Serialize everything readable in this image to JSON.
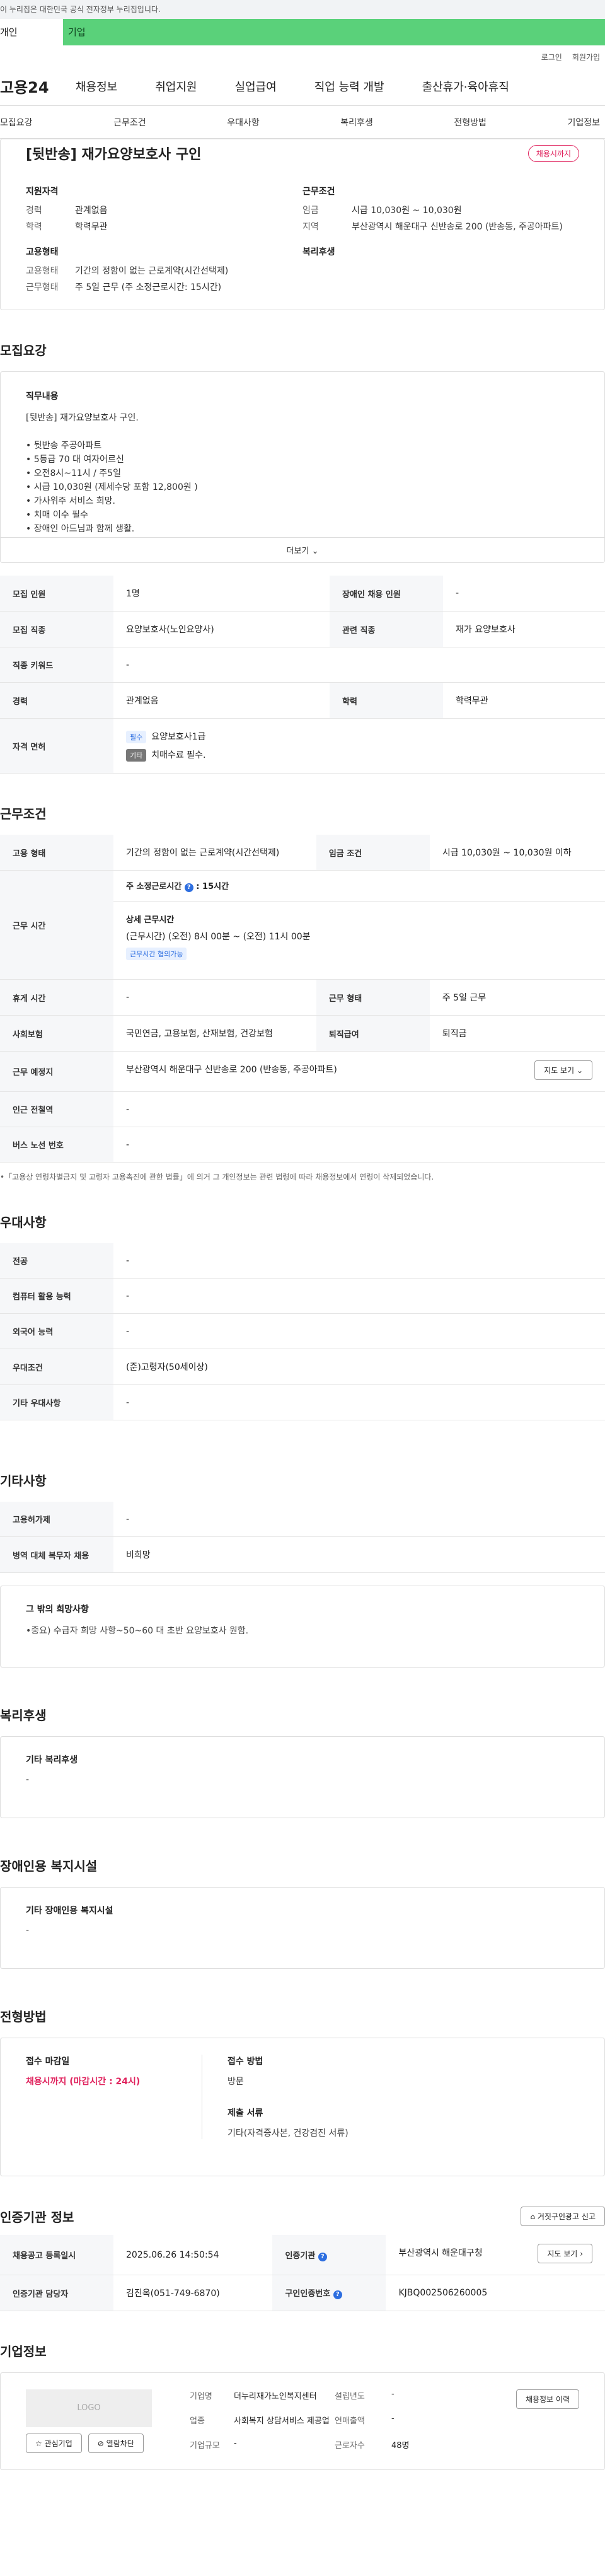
{
  "topbar": "이 누리집은 대한민국 공식 전자정부 누리집입니다.",
  "tabs": {
    "person": "개인",
    "company": "기업"
  },
  "util": {
    "login": "로그인",
    "join": "회원가입"
  },
  "logo": "고용24",
  "gnb": [
    "채용정보",
    "취업지원",
    "실업급여",
    "직업 능력 개발",
    "출산휴가·육아휴직"
  ],
  "subnav": [
    "모집요강",
    "근무조건",
    "우대사항",
    "복리후생",
    "전형방법",
    "기업정보"
  ],
  "job": {
    "title": "[뒷반송] 재가요양보호사 구인",
    "deadline_badge": "채용시까지",
    "qual_title": "지원자격",
    "career_label": "경력",
    "career": "관계없음",
    "edu_label": "학력",
    "edu": "학력무관",
    "cond_title": "근무조건",
    "wage_label": "임금",
    "wage": "시급 10,030원 ~ 10,030원",
    "area_label": "지역",
    "area": "부산광역시 해운대구 신반송로 200 (반송동, 주공아파트)",
    "type_title": "고용형태",
    "emp_label": "고용형태",
    "emp": "기간의 정함이 없는 근로계약(시간선택제)",
    "work_label": "근무형태",
    "work": "주 5일 근무 (주 소정근로시간: 15시간)",
    "welfare_title": "복리후생"
  },
  "recruit": {
    "section": "모집요강",
    "desc_title": "직무내용",
    "desc_lines": [
      "[뒷반송] 재가요양보호사 구인.",
      "",
      "• 뒷반송 주공아파트",
      "• 5등급 70 대 여자어르신",
      "• 오전8시~11시 / 주5일",
      "• 시급 10,030원 (제세수당 포함 12,800원 )",
      "• 가사위주 서비스 희망.",
      "• 치매 이수 필수",
      "• 장애인 아드님과 함께 생활."
    ],
    "more": "더보기",
    "rows": {
      "count_label": "모집 인원",
      "count": "1명",
      "disabled_label": "장애인 채용 인원",
      "disabled": "-",
      "job_label": "모집 직종",
      "job": "요양보호사(노인요양사)",
      "related_label": "관련 직종",
      "related": "재가 요양보호사",
      "keyword_label": "직종 키워드",
      "keyword": "-",
      "career_label": "경력",
      "career": "관계없음",
      "edu_label": "학력",
      "edu": "학력무관",
      "license_label": "자격 면허",
      "license_tag1": "필수",
      "license1": "요양보호사1급",
      "license_tag2": "기타",
      "license2": "치매수료 필수."
    }
  },
  "conditions": {
    "section": "근무조건",
    "emp_label": "고용 형태",
    "emp": "기간의 정함이 없는 근로계약(시간선택제)",
    "wage_label": "임금 조건",
    "wage": "시급 10,030원 ~ 10,030원 이하",
    "time_label": "근무 시간",
    "weekly": "주 소정근로시간",
    "weekly_hours": "15시간",
    "detail_title": "상세 근무시간",
    "detail": "(근무시간) (오전) 8시 00분 ~ (오전) 11시 00분",
    "detail_tag": "근무시간 협의가능",
    "rest_label": "휴게 시간",
    "rest": "-",
    "form_label": "근무 형태",
    "form": "주 5일 근무",
    "insurance_label": "사회보험",
    "insurance": "국민연금, 고용보험, 산재보험, 건강보험",
    "severance_label": "퇴직급여",
    "severance": "퇴직금",
    "place_label": "근무 예정지",
    "place": "부산광역시 해운대구 신반송로 200 (반송동, 주공아파트)",
    "map_btn": "지도 보기",
    "station_label": "인근 전철역",
    "station": "-",
    "bus_label": "버스 노선 번호",
    "bus": "-",
    "note": "•「고용상 연령차별금지 및 고령자 고용촉진에 관한 법률」에 의거 그 개인정보는 관련 법령에 따라 채용정보에서 연령이 삭제되었습니다."
  },
  "preference": {
    "section": "우대사항",
    "rows": [
      {
        "label": "전공",
        "value": "-"
      },
      {
        "label": "컴퓨터 활용 능력",
        "value": "-"
      },
      {
        "label": "외국어 능력",
        "value": "-"
      },
      {
        "label": "우대조건",
        "value": "(준)고령자(50세이상)"
      },
      {
        "label": "기타 우대사항",
        "value": "-"
      }
    ]
  },
  "other": {
    "section": "기타사항",
    "rows": [
      {
        "label": "고용허가제",
        "value": "-"
      },
      {
        "label": "병역 대체 복무자 채용",
        "value": "비희망"
      }
    ],
    "extra_title": "그 밖의 희망사항",
    "extra": "•중요) 수급자 희망 사항~50~60 대 초반 요양보호사 원함."
  },
  "welfare": {
    "section": "복리후생",
    "title": "기타 복리후생",
    "value": "-"
  },
  "disabled_facility": {
    "section": "장애인용 복지시설",
    "title": "기타 장애인용 복지시설",
    "value": "-"
  },
  "selection": {
    "section": "전형방법",
    "deadline_title": "접수 마감일",
    "deadline": "채용시까지 (마감시간 : 24시)",
    "method_title": "접수 방법",
    "method": "방문",
    "docs_title": "제출 서류",
    "docs": "기타(자격증사본, 건강검진 서류)"
  },
  "cert": {
    "section": "인증기관 정보",
    "report_btn": "거짓구인광고 신고",
    "reg_label": "채용공고 등록일시",
    "reg": "2025.06.26 14:50:54",
    "org_label": "인증기관",
    "org": "부산광역시 해운대구청",
    "map_btn": "지도 보기",
    "manager_label": "인증기관 담당자",
    "manager": "김진옥(051-749-6870)",
    "num_label": "구인인증번호",
    "num": "KJBQ002506260005"
  },
  "company": {
    "section": "기업정보",
    "logo": "LOGO",
    "fav_btn": "관심기업",
    "block_btn": "열람차단",
    "name_label": "기업명",
    "name": "더누리재가노인복지센터",
    "industry_label": "업종",
    "industry": "사회복지 상담서비스 제공업",
    "size_label": "기업규모",
    "size": "-",
    "founded_label": "설립년도",
    "founded": "-",
    "sales_label": "연매출액",
    "sales": "-",
    "employees_label": "근로자수",
    "employees": "48명",
    "history_btn": "채용정보 이력"
  }
}
